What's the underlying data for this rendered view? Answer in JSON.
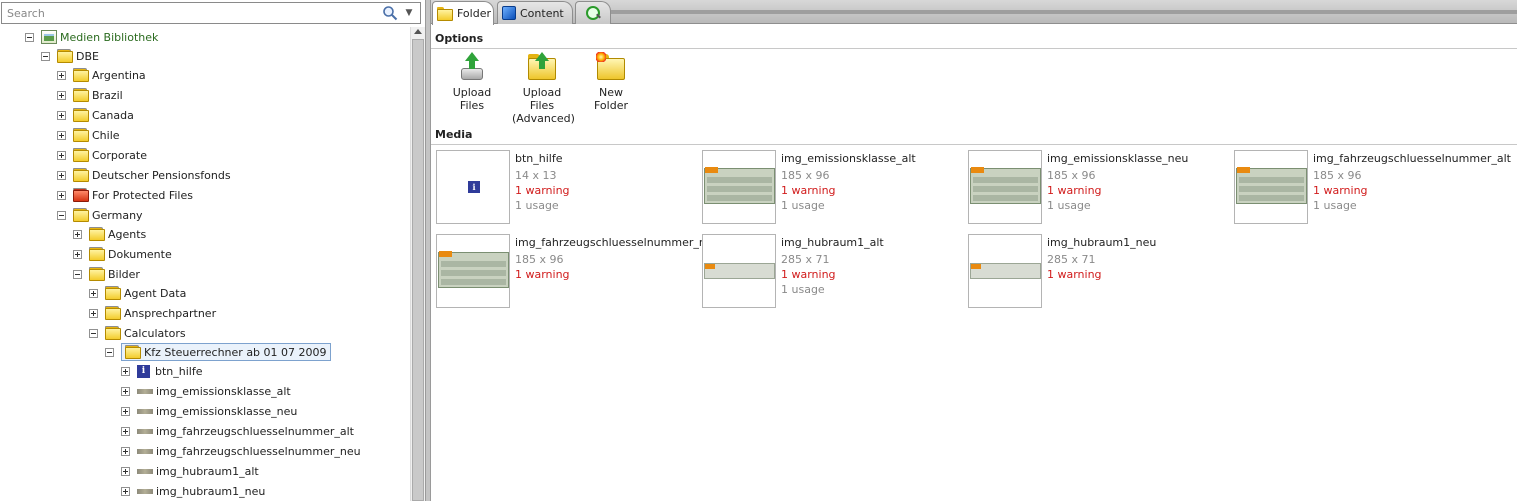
{
  "search": {
    "placeholder": "Search"
  },
  "tree": {
    "root": "Medien Bibliothek",
    "dbe": "DBE",
    "items": [
      "Argentina",
      "Brazil",
      "Canada",
      "Chile",
      "Corporate",
      "Deutscher Pensionsfonds",
      "For Protected Files",
      "Germany"
    ],
    "germany_children": [
      "Agents",
      "Dokumente",
      "Bilder"
    ],
    "bilder_children": [
      "Agent Data",
      "Ansprechpartner",
      "Calculators"
    ],
    "calculators_child": "Kfz Steuerrechner ab 01 07 2009",
    "files": [
      "btn_hilfe",
      "img_emissionsklasse_alt",
      "img_emissionsklasse_neu",
      "img_fahrzeugschluesselnummer_alt",
      "img_fahrzeugschluesselnummer_neu",
      "img_hubraum1_alt",
      "img_hubraum1_neu"
    ]
  },
  "tabs": {
    "folder": "Folder",
    "content": "Content"
  },
  "options": {
    "heading": "Options",
    "upload_files": "Upload Files",
    "upload_advanced_line1": "Upload Files",
    "upload_advanced_line2": "(Advanced)",
    "new_folder": "New Folder"
  },
  "media": {
    "heading": "Media",
    "items": [
      {
        "name": "btn_hilfe",
        "dims": "14 x 13",
        "warning": "1 warning",
        "usage": "1 usage"
      },
      {
        "name": "img_emissionsklasse_alt",
        "dims": "185 x 96",
        "warning": "1 warning",
        "usage": "1 usage"
      },
      {
        "name": "img_emissionsklasse_neu",
        "dims": "185 x 96",
        "warning": "1 warning",
        "usage": "1 usage"
      },
      {
        "name": "img_fahrzeugschluesselnummer_alt",
        "dims": "185 x 96",
        "warning": "1 warning",
        "usage": "1 usage"
      },
      {
        "name": "img_fahrzeugschluesselnummer_neu",
        "dims": "185 x 96",
        "warning": "1 warning",
        "usage": ""
      },
      {
        "name": "img_hubraum1_alt",
        "dims": "285 x 71",
        "warning": "1 warning",
        "usage": "1 usage"
      },
      {
        "name": "img_hubraum1_neu",
        "dims": "285 x 71",
        "warning": "1 warning",
        "usage": ""
      }
    ]
  },
  "colors": {
    "warning": "#d11c1c",
    "root_label": "#2b6b1f",
    "selection": "#eaf2fb"
  }
}
